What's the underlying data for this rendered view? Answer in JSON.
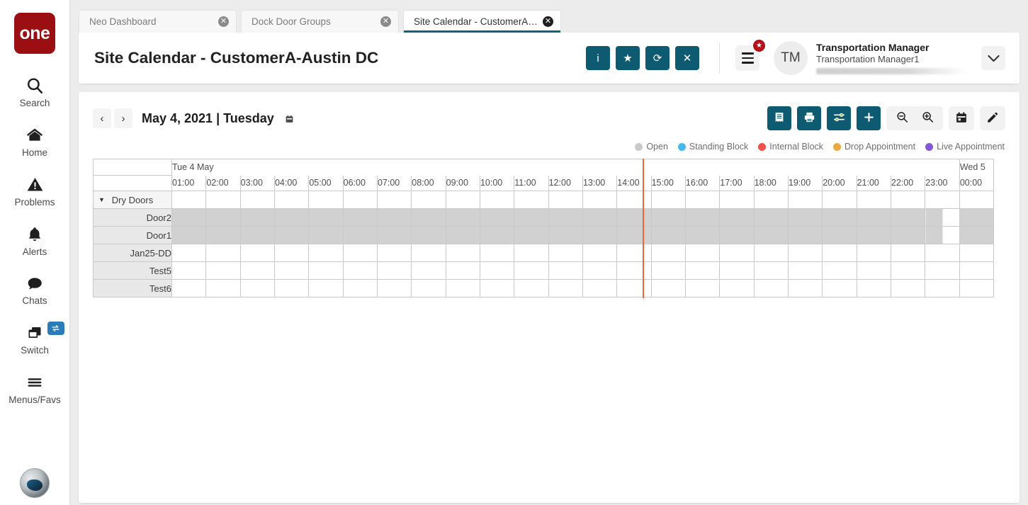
{
  "brand": {
    "logo_text": "one"
  },
  "rail": {
    "items": [
      {
        "label": "Search",
        "icon": "search-icon"
      },
      {
        "label": "Home",
        "icon": "home-icon"
      },
      {
        "label": "Problems",
        "icon": "warning-triangle-icon"
      },
      {
        "label": "Alerts",
        "icon": "bell-icon"
      },
      {
        "label": "Chats",
        "icon": "chat-bubble-icon"
      },
      {
        "label": "Switch",
        "icon": "windows-stack-icon",
        "badge_icon": "swap-arrows-icon"
      },
      {
        "label": "Menus/Favs",
        "icon": "hamburger-icon"
      }
    ]
  },
  "tabs": [
    {
      "title": "Neo Dashboard",
      "active": false
    },
    {
      "title": "Dock Door Groups",
      "active": false
    },
    {
      "title": "Site Calendar - CustomerA-Austi...",
      "active": true
    }
  ],
  "header": {
    "page_title": "Site Calendar - CustomerA-Austin DC",
    "actions": [
      {
        "name": "info-button",
        "glyph": "i"
      },
      {
        "name": "favorite-button",
        "glyph": "★"
      },
      {
        "name": "refresh-button",
        "glyph": "⟳"
      },
      {
        "name": "close-button",
        "glyph": "✕"
      }
    ],
    "notification_badge": "★",
    "avatar_initials": "TM",
    "user_name": "Transportation Manager",
    "user_role": "Transportation Manager1"
  },
  "calendar": {
    "prev_label": "‹",
    "next_label": "›",
    "date_label": "May 4, 2021 | Tuesday",
    "date_icon": "calendar-icon",
    "toolbar": [
      {
        "name": "report-button",
        "icon": "document-list-icon",
        "style": "teal"
      },
      {
        "name": "print-button",
        "icon": "printer-icon",
        "style": "teal"
      },
      {
        "name": "filter-settings-button",
        "icon": "sliders-icon",
        "style": "teal"
      },
      {
        "name": "add-appointment-button",
        "icon": "plus-icon",
        "style": "teal"
      },
      {
        "name": "zoom-out-button",
        "icon": "zoom-out-icon",
        "style": "light-group"
      },
      {
        "name": "zoom-in-button",
        "icon": "zoom-in-icon",
        "style": "light-group"
      },
      {
        "name": "date-picker-button",
        "icon": "calendar-icon",
        "style": "light"
      },
      {
        "name": "edit-button",
        "icon": "pencil-icon",
        "style": "light"
      }
    ],
    "legend": [
      {
        "label": "Open",
        "color": "#c9c9c9"
      },
      {
        "label": "Standing Block",
        "color": "#43b9ec"
      },
      {
        "label": "Internal Block",
        "color": "#f4504b"
      },
      {
        "label": "Drop Appointment",
        "color": "#e9a93c"
      },
      {
        "label": "Live Appointment",
        "color": "#8257d8"
      }
    ],
    "day_headers": [
      {
        "label": "Tue 4 May",
        "span": 23
      },
      {
        "label": "Wed 5",
        "span": 1
      }
    ],
    "hours": [
      "01:00",
      "02:00",
      "03:00",
      "04:00",
      "05:00",
      "06:00",
      "07:00",
      "08:00",
      "09:00",
      "10:00",
      "11:00",
      "12:00",
      "13:00",
      "14:00",
      "15:00",
      "16:00",
      "17:00",
      "18:00",
      "19:00",
      "20:00",
      "21:00",
      "22:00",
      "23:00",
      "00:00"
    ],
    "rows": [
      {
        "label": "Dry Doors",
        "type": "group",
        "caret": "▼",
        "slots": []
      },
      {
        "label": "Door2",
        "type": "door",
        "slots": [
          "open",
          "open",
          "open",
          "open",
          "open",
          "open",
          "open",
          "open",
          "open",
          "open",
          "open",
          "open",
          "open",
          "open",
          "open",
          "open",
          "open",
          "open",
          "open",
          "open",
          "open",
          "open",
          "half-open",
          "open"
        ]
      },
      {
        "label": "Door1",
        "type": "door",
        "slots": [
          "open",
          "open",
          "open",
          "open",
          "open",
          "open",
          "open",
          "open",
          "open",
          "open",
          "open",
          "open",
          "open",
          "open",
          "open",
          "open",
          "open",
          "open",
          "open",
          "open",
          "open",
          "open",
          "half-open",
          "open"
        ]
      },
      {
        "label": "Jan25-DD",
        "type": "door",
        "slots": [
          "",
          "",
          "",
          "",
          "",
          "",
          "",
          "",
          "",
          "",
          "",
          "",
          "",
          "",
          "",
          "",
          "",
          "",
          "",
          "",
          "",
          "",
          "",
          ""
        ]
      },
      {
        "label": "Test5",
        "type": "door",
        "slots": [
          "",
          "",
          "",
          "",
          "",
          "",
          "",
          "",
          "",
          "",
          "",
          "",
          "",
          "",
          "",
          "",
          "",
          "",
          "",
          "",
          "",
          "",
          "",
          ""
        ]
      },
      {
        "label": "Test6",
        "type": "door",
        "slots": [
          "",
          "",
          "",
          "",
          "",
          "",
          "",
          "",
          "",
          "",
          "",
          "",
          "",
          "",
          "",
          "",
          "",
          "",
          "",
          "",
          "",
          "",
          "",
          ""
        ]
      }
    ],
    "now_line": {
      "color": "#f4633a",
      "hour_index": 13,
      "fraction": 0.75
    }
  }
}
